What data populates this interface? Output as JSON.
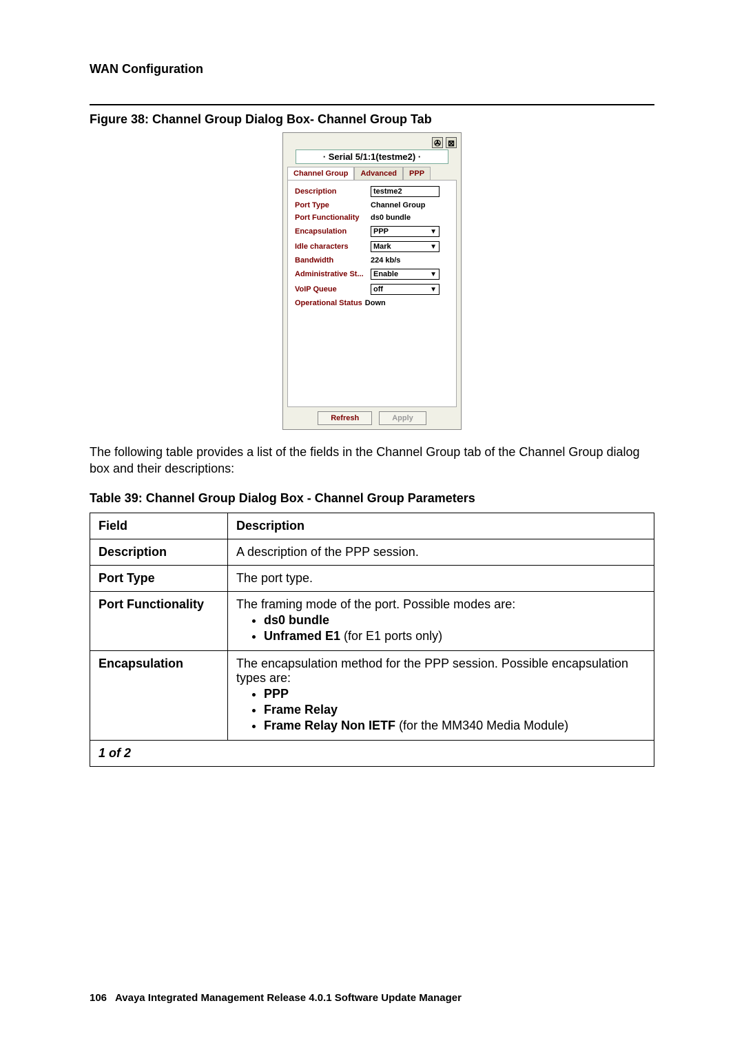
{
  "header": {
    "section_title": "WAN Configuration"
  },
  "figure": {
    "caption": "Figure 38: Channel Group Dialog Box- Channel Group Tab"
  },
  "dialog": {
    "close_glyph": "⊠",
    "pin_glyph": "✇",
    "title": "· Serial 5/1:1(testme2) ·",
    "tabs": [
      "Channel Group",
      "Advanced",
      "PPP"
    ],
    "fields": {
      "description": {
        "label": "Description",
        "value": "testme2"
      },
      "port_type": {
        "label": "Port Type",
        "value": "Channel Group"
      },
      "port_functionality": {
        "label": "Port Functionality",
        "value": "ds0 bundle"
      },
      "encapsulation": {
        "label": "Encapsulation",
        "value": "PPP"
      },
      "idle_characters": {
        "label": "Idle characters",
        "value": "Mark"
      },
      "bandwidth": {
        "label": "Bandwidth",
        "value": "224 kb/s"
      },
      "admin_status": {
        "label": "Administrative St...",
        "value": "Enable"
      },
      "voip_queue": {
        "label": "VoIP Queue",
        "value": "off"
      },
      "op_status": {
        "label": "Operational Status",
        "value": "Down"
      }
    },
    "buttons": {
      "refresh": "Refresh",
      "apply": "Apply"
    }
  },
  "paragraph": "The following table provides a list of the fields in the Channel Group tab of the Channel Group dialog box and their descriptions:",
  "table": {
    "caption": "Table 39: Channel Group Dialog Box - Channel Group Parameters",
    "head": {
      "field": "Field",
      "description": "Description"
    },
    "rows": {
      "r1": {
        "field": "Description",
        "desc": "A description of the PPP session."
      },
      "r2": {
        "field": "Port Type",
        "desc": "The port type."
      },
      "r3": {
        "field": "Port Functionality",
        "intro": "The framing mode of the port. Possible modes are:",
        "b1": "ds0 bundle",
        "b2_bold": "Unframed E1",
        "b2_rest": " (for E1 ports only)"
      },
      "r4": {
        "field": "Encapsulation",
        "intro": "The encapsulation method for the PPP session. Possible encapsulation types are:",
        "b1": "PPP",
        "b2": "Frame Relay",
        "b3_bold": "Frame Relay Non IETF",
        "b3_rest": " (for the MM340 Media Module)"
      }
    },
    "pager": "1 of 2"
  },
  "footer": {
    "page_number": "106",
    "doc_title": "Avaya Integrated Management Release 4.0.1 Software Update Manager"
  }
}
